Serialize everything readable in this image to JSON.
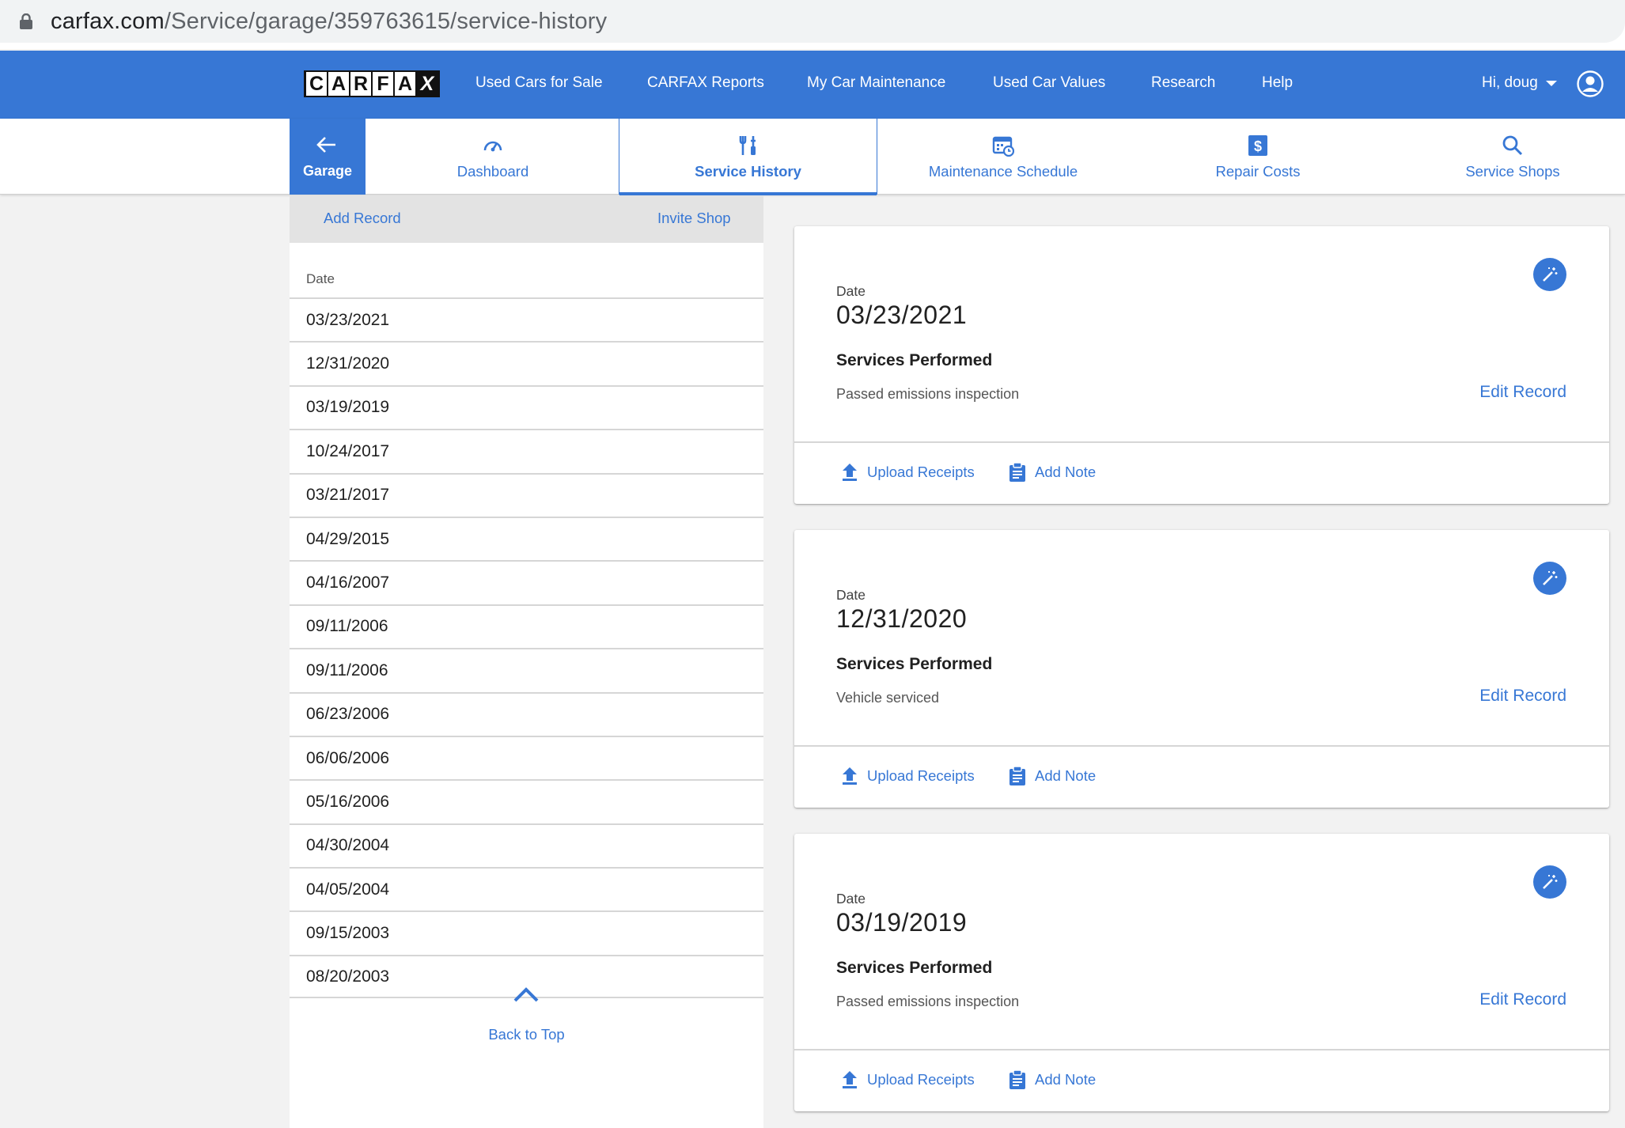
{
  "browser": {
    "url_host": "carfax.com",
    "url_path": "/Service/garage/359763615/service-history"
  },
  "topnav": {
    "logo_letters": [
      "C",
      "A",
      "R",
      "F",
      "A",
      "X"
    ],
    "links": [
      "Used Cars for Sale",
      "CARFAX Reports",
      "My Car Maintenance",
      "Used Car Values",
      "Research",
      "Help"
    ],
    "user_greeting": "Hi, doug"
  },
  "subnav": {
    "garage_label": "Garage",
    "tabs": [
      {
        "label": "Dashboard",
        "icon": "speedometer-icon"
      },
      {
        "label": "Service History",
        "icon": "tools-icon",
        "active": true
      },
      {
        "label": "Maintenance Schedule",
        "icon": "calendar-clock-icon"
      },
      {
        "label": "Repair Costs",
        "icon": "dollar-icon"
      },
      {
        "label": "Service Shops",
        "icon": "search-icon"
      }
    ]
  },
  "left": {
    "add_record": "Add Record",
    "invite_shop": "Invite Shop",
    "date_header": "Date",
    "dates": [
      "03/23/2021",
      "12/31/2020",
      "03/19/2019",
      "10/24/2017",
      "03/21/2017",
      "04/29/2015",
      "04/16/2007",
      "09/11/2006",
      "09/11/2006",
      "06/23/2006",
      "06/06/2006",
      "05/16/2006",
      "04/30/2004",
      "04/05/2004",
      "09/15/2003",
      "08/20/2003"
    ],
    "back_to_top": "Back to Top"
  },
  "cards": [
    {
      "date_label": "Date",
      "date": "03/23/2021",
      "services_heading": "Services Performed",
      "service": "Passed emissions inspection",
      "edit": "Edit Record",
      "upload": "Upload Receipts",
      "note": "Add Note"
    },
    {
      "date_label": "Date",
      "date": "12/31/2020",
      "services_heading": "Services Performed",
      "service": "Vehicle serviced",
      "edit": "Edit Record",
      "upload": "Upload Receipts",
      "note": "Add Note"
    },
    {
      "date_label": "Date",
      "date": "03/19/2019",
      "services_heading": "Services Performed",
      "service": "Passed emissions inspection",
      "edit": "Edit Record",
      "upload": "Upload Receipts",
      "note": "Add Note"
    }
  ],
  "colors": {
    "brand_blue": "#3777d5",
    "page_bg": "#f2f2f2"
  }
}
